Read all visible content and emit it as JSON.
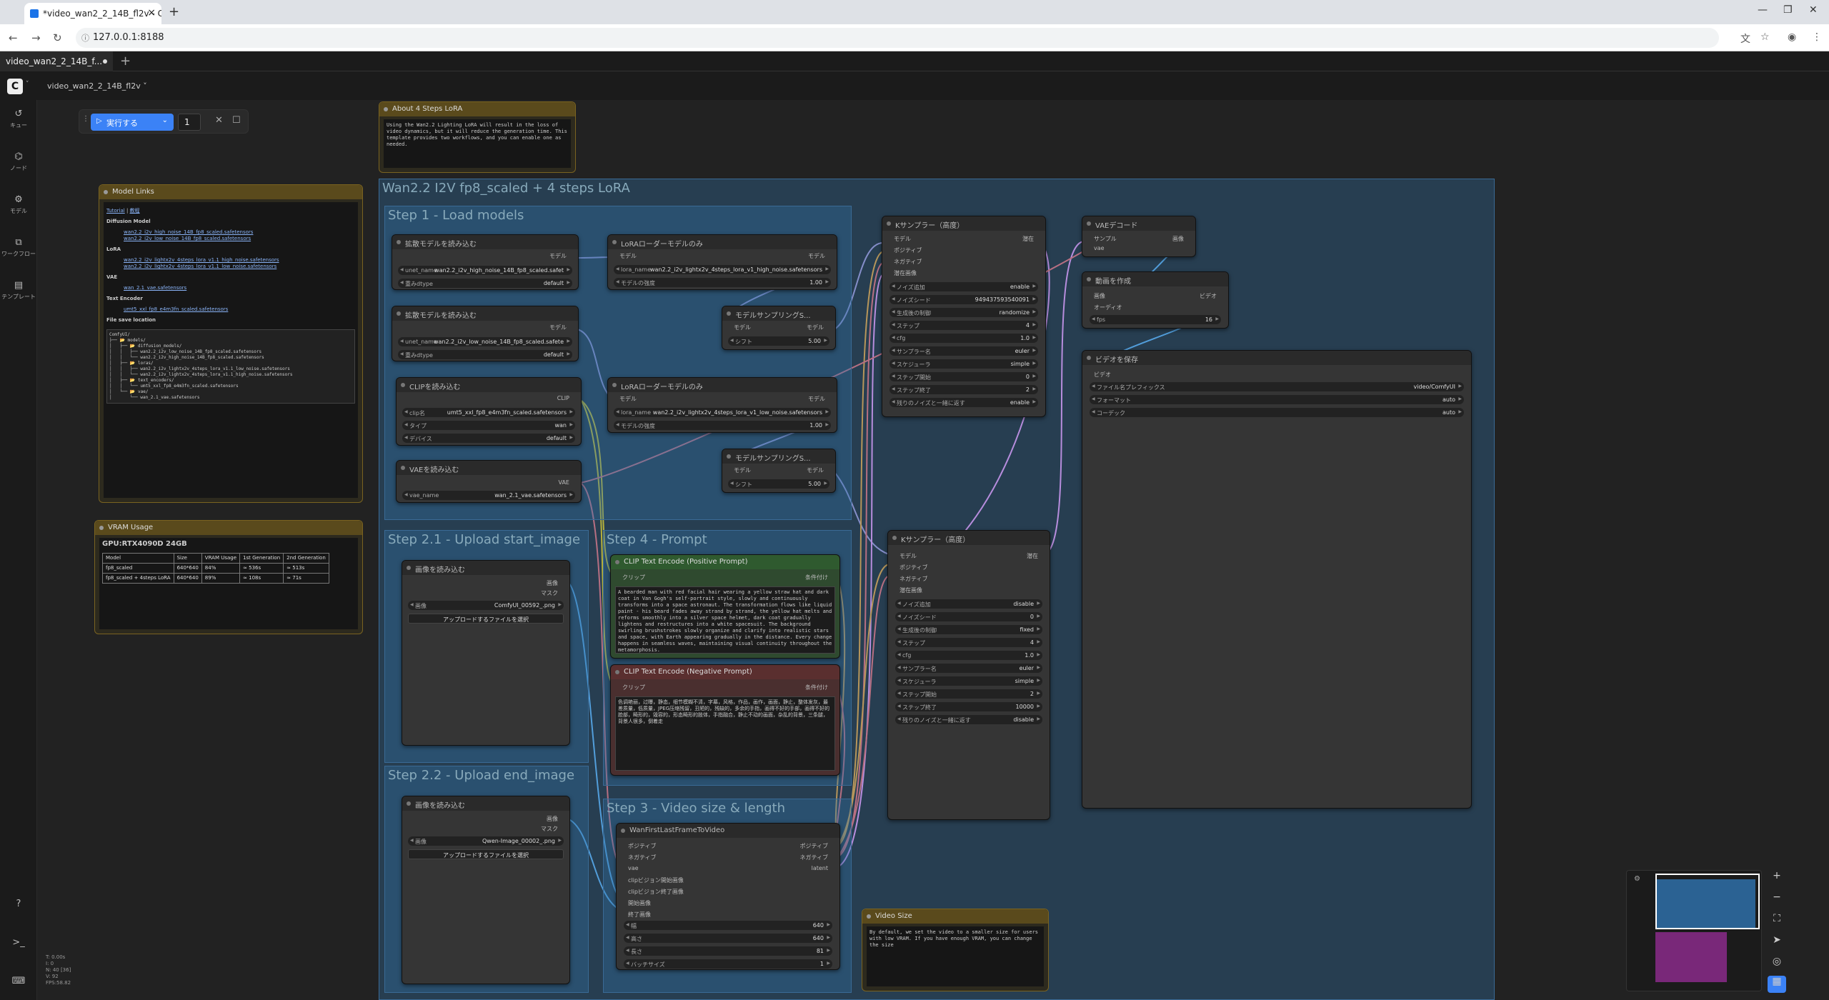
{
  "browser": {
    "tab_title": "*video_wan2_2_14B_fl2v - Com",
    "url": "127.0.0.1:8188"
  },
  "comfy": {
    "workflow_tab": "video_wan2_2_14B_f...",
    "workflow_menu": "video_wan2_2_14B_fl2v ˅",
    "logo": "C"
  },
  "sidebar": [
    {
      "label": "キュー",
      "icon": "history-icon"
    },
    {
      "label": "ノード",
      "icon": "node-icon"
    },
    {
      "label": "モデル",
      "icon": "model-icon"
    },
    {
      "label": "ワークフロー",
      "icon": "workflow-icon"
    },
    {
      "label": "テンプレート",
      "icon": "template-icon"
    }
  ],
  "stats": [
    "T: 0.00s",
    "I: 0",
    "N: 40 [36]",
    "V: 92",
    "FPS:58.82"
  ],
  "toolbar": {
    "run": "実行する",
    "count": "1"
  },
  "groups": {
    "main": "Wan2.2 I2V fp8_scaled + 4 steps LoRA",
    "step1": "Step 1 - Load models",
    "step21": "Step 2.1 - Upload start_image",
    "step22": "Step 2.2 - Upload end_image",
    "step3": "Step 3 - Video size & length",
    "step4": "Step 4 - Prompt"
  },
  "notes": {
    "about_title": "About 4 Steps LoRA",
    "about_text": "Using the Wan2.2 Lighting LoRA will result in the loss of video dynamics, but it will reduce the generation time. This template provides two workflows, and you can enable one as needed.",
    "links_title": "Model Links",
    "links_tut1": "Tutorial",
    "links_tut2": "教程",
    "links_diff": "Diffusion Model",
    "links_d1": "wan2.2_i2v_high_noise_14B_fp8_scaled.safetensors",
    "links_d2": "wan2.2_i2v_low_noise_14B_fp8_scaled.safetensors",
    "links_lora": "LoRA",
    "links_l1": "wan2.2_i2v_lightx2v_4steps_lora_v1.1_high_noise.safetensors",
    "links_l2": "wan2.2_i2v_lightx2v_4steps_lora_v1.1_low_noise.safetensors",
    "links_vae": "VAE",
    "links_v1": "wan_2.1_vae.safetensors",
    "links_te": "Text Encoder",
    "links_t1": "umt5_xxl_fp8_e4m3fn_scaled.safetensors",
    "links_fsl": "File save location",
    "tree": [
      "ComfyUI/",
      "├── 📂 models/",
      "│   ├── 📂 diffusion_models/",
      "│   │   ├── wan2.2_i2v_low_noise_14B_fp8_scaled.safetensors",
      "│   │   └── wan2.2_i2v_high_noise_14B_fp8_scaled.safetensors",
      "│   ├── 📂 loras/",
      "│   │   ├── wan2.2_i2v_lightx2v_4steps_lora_v1.1_low_noise.safetensors",
      "│   │   └── wan2.2_i2v_lightx2v_4steps_lora_v1.1_high_noise.safetensors",
      "│   ├── 📂 text_encoders/",
      "│   │   └── umt5_xxl_fp8_e4m3fn_scaled.safetensors",
      "│   └── 📂 vae/",
      "│       └── wan_2.1_vae.safetensors"
    ],
    "vram_title": "VRAM Usage",
    "vram_gpu": "GPU:RTX4090D 24GB",
    "vram_head": [
      "Model",
      "Size",
      "VRAM Usage",
      "1st Generation",
      "2nd Generation"
    ],
    "vram_r1": [
      "fp8_scaled",
      "640*640",
      "84%",
      "≈ 536s",
      "≈ 513s"
    ],
    "vram_r2": [
      "fp8_scaled + 4steps LoRA",
      "640*640",
      "89%",
      "≈ 108s",
      "≈ 71s"
    ],
    "vsize_title": "Video Size",
    "vsize_text": "By default, we set the video to a smaller size for users with low VRAM. If you have enough VRAM, you can change the size"
  },
  "nodes": {
    "unet1": {
      "title": "拡散モデルを読み込む",
      "out": "モデル",
      "w1l": "unet_name",
      "w1": "wan2.2_i2v_high_noise_14B_fp8_scaled.safet",
      "w2l": "重みdtype",
      "w2": "default"
    },
    "unet2": {
      "title": "拡散モデルを読み込む",
      "out": "モデル",
      "w1l": "unet_name",
      "w1": "wan2.2_i2v_low_noise_14B_fp8_scaled.safete",
      "w2l": "重みdtype",
      "w2": "default"
    },
    "clip": {
      "title": "CLIPを読み込む",
      "out": "CLIP",
      "w1l": "clip名",
      "w1": "umt5_xxl_fp8_e4m3fn_scaled.safetensors",
      "w2l": "タイプ",
      "w2": "wan",
      "w3l": "デバイス",
      "w3": "default"
    },
    "vae": {
      "title": "VAEを読み込む",
      "out": "VAE",
      "w1l": "vae_name",
      "w1": "wan_2.1_vae.safetensors"
    },
    "lora1": {
      "title": "LoRAローダーモデルのみ",
      "in": "モデル",
      "out": "モデル",
      "w1l": "lora_name",
      "w1": "wan2.2_i2v_lightx2v_4steps_lora_v1_high_noise.safetensors",
      "w2l": "モデルの強度",
      "w2": "1.00"
    },
    "lora2": {
      "title": "LoRAローダーモデルのみ",
      "in": "モデル",
      "out": "モデル",
      "w1l": "lora_name",
      "w1": "wan2.2_i2v_lightx2v_4steps_lora_v1_low_noise.safetensors",
      "w2l": "モデルの強度",
      "w2": "1.00"
    },
    "ms1": {
      "title": "モデルサンプリングS...",
      "in": "モデル",
      "out": "モデル",
      "w1l": "シフト",
      "w1": "5.00"
    },
    "ms2": {
      "title": "モデルサンプリングS...",
      "in": "モデル",
      "out": "モデル",
      "w1l": "シフト",
      "w1": "5.00"
    },
    "img1": {
      "title": "画像を読み込む",
      "o1": "画像",
      "o2": "マスク",
      "w1l": "画像",
      "w1": "ComfyUI_00592_.png",
      "btn": "アップロードするファイルを選択"
    },
    "img2": {
      "title": "画像を読み込む",
      "o1": "画像",
      "o2": "マスク",
      "w1l": "画像",
      "w1": "Qwen-Image_00002_.png",
      "btn": "アップロードするファイルを選択"
    },
    "pos": {
      "title": "CLIP Text Encode (Positive Prompt)",
      "in": "クリップ",
      "out": "条件付け",
      "text": "A bearded man with red facial hair wearing a yellow straw hat and dark coat in Van Gogh's self-portrait style, slowly and continuously transforms into a space astronaut. The transformation flows like liquid paint - his beard fades away strand by strand, the yellow hat melts and reforms smoothly into a silver space helmet, dark coat gradually lightens and restructures into a white spacesuit. The background swirling brushstrokes slowly organize and clarify into realistic stars and space, with Earth appearing gradually in the distance. Every change happens in seamless waves, maintaining visual continuity throughout the metamorphosis.\n\nConsistent soft lighting throughout, medium close-up maintaining same"
    },
    "neg": {
      "title": "CLIP Text Encode (Negative Prompt)",
      "in": "クリップ",
      "out": "条件付け",
      "text": "色调艳丽，过曝，静态，细节模糊不清，字幕，风格，作品，画作，画面，静止，整体发灰，最差质量，低质量，JPEG压缩残留，丑陋的，残缺的，多余的手指，画得不好的手部，画得不好的脸部，畸形的，毁容的，形态畸形的肢体，手指融合，静止不动的画面，杂乱的背景，三条腿，背景人很多，倒着走"
    },
    "wan": {
      "title": "WanFirstLastFrameToVideo",
      "i1": "ポジティブ",
      "i2": "ネガティブ",
      "i3": "vae",
      "i4": "clipビジョン開始画像",
      "i5": "clipビジョン終了画像",
      "i6": "開始画像",
      "i7": "終了画像",
      "o1": "ポジティブ",
      "o2": "ネガティブ",
      "o3": "latent",
      "w1l": "幅",
      "w1": "640",
      "w2l": "高さ",
      "w2": "640",
      "w3l": "長さ",
      "w3": "81",
      "w4l": "バッチサイズ",
      "w4": "1"
    },
    "ks1": {
      "title": "Kサンプラー（高度）",
      "i1": "モデル",
      "i2": "ポジティブ",
      "i3": "ネガティブ",
      "i4": "潜在画像",
      "out": "潜在",
      "w": [
        [
          "ノイズ追加",
          "enable"
        ],
        [
          "ノイズシード",
          "949437593540091"
        ],
        [
          "生成後の制御",
          "randomize"
        ],
        [
          "ステップ",
          "4"
        ],
        [
          "cfg",
          "1.0"
        ],
        [
          "サンプラー名",
          "euler"
        ],
        [
          "スケジューラ",
          "simple"
        ],
        [
          "ステップ開始",
          "0"
        ],
        [
          "ステップ終了",
          "2"
        ],
        [
          "残りのノイズと一緒に返す",
          "enable"
        ]
      ]
    },
    "ks2": {
      "title": "Kサンプラー（高度）",
      "i1": "モデル",
      "i2": "ポジティブ",
      "i3": "ネガティブ",
      "i4": "潜在画像",
      "out": "潜在",
      "w": [
        [
          "ノイズ追加",
          "disable"
        ],
        [
          "ノイズシード",
          "0"
        ],
        [
          "生成後の制御",
          "fixed"
        ],
        [
          "ステップ",
          "4"
        ],
        [
          "cfg",
          "1.0"
        ],
        [
          "サンプラー名",
          "euler"
        ],
        [
          "スケジューラ",
          "simple"
        ],
        [
          "ステップ開始",
          "2"
        ],
        [
          "ステップ終了",
          "10000"
        ],
        [
          "残りのノイズと一緒に返す",
          "disable"
        ]
      ]
    },
    "vaedec": {
      "title": "VAEデコード",
      "i1": "サンプル",
      "i2": "vae",
      "out": "画像"
    },
    "mkvid": {
      "title": "動画を作成",
      "i1": "画像",
      "i2": "オーディオ",
      "out": "ビデオ",
      "w1l": "fps",
      "w1": "16"
    },
    "savevid": {
      "title": "ビデオを保存",
      "i1": "ビデオ",
      "w": [
        [
          "ファイル名プレフィックス",
          "video/ComfyUI"
        ],
        [
          "フォーマット",
          "auto"
        ],
        [
          "コーデック",
          "auto"
        ]
      ]
    }
  },
  "colors": {
    "accent": "#3b82f6",
    "group": "#3273aa",
    "positive": "#2f5a2f",
    "negative": "#5a2f2f",
    "note": "#5a4a1c"
  }
}
